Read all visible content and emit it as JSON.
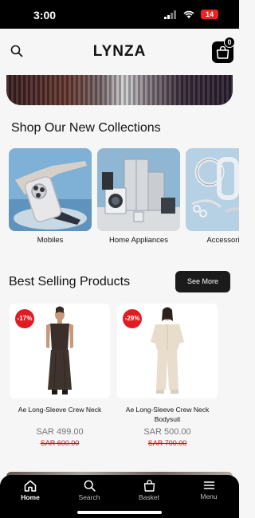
{
  "status_bar": {
    "time": "3:00",
    "battery": "14"
  },
  "header": {
    "brand": "LYNZA",
    "cart_count": "0"
  },
  "collections": {
    "title": "Shop Our New Collections",
    "items": [
      {
        "label": "Mobiles"
      },
      {
        "label": "Home Appliances"
      },
      {
        "label": "Accessories"
      }
    ]
  },
  "best_selling": {
    "title": "Best Selling Products",
    "see_more_label": "See More",
    "products": [
      {
        "discount": "-17%",
        "name": "Ae Long-Sleeve Crew Neck",
        "price": "SAR 499.00",
        "old_price": "SAR 600.00"
      },
      {
        "discount": "-29%",
        "name": "Ae Long-Sleeve Crew Neck Bodysuit",
        "price": "SAR 500.00",
        "old_price": "SAR 700.00"
      }
    ]
  },
  "tab_bar": {
    "tabs": [
      {
        "label": "Home",
        "icon": "home-icon"
      },
      {
        "label": "Search",
        "icon": "search-icon"
      },
      {
        "label": "Basket",
        "icon": "basket-icon"
      },
      {
        "label": "Menu",
        "icon": "menu-icon"
      }
    ],
    "active": "Home"
  }
}
